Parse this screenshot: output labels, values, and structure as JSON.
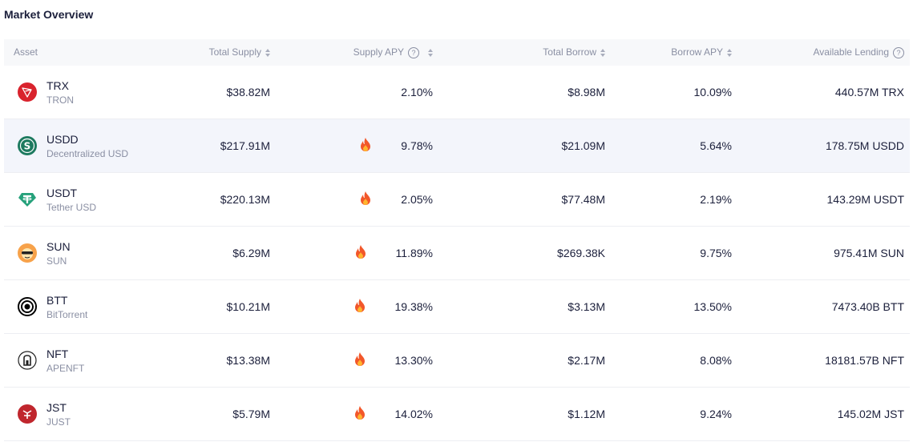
{
  "page": {
    "title": "Market Overview"
  },
  "table": {
    "headers": {
      "asset": "Asset",
      "total_supply": "Total Supply",
      "supply_apy": "Supply APY",
      "total_borrow": "Total Borrow",
      "borrow_apy": "Borrow APY",
      "available_lending": "Available Lending"
    },
    "rows": [
      {
        "symbol": "TRX",
        "name": "TRON",
        "total_supply": "$38.82M",
        "supply_apy": "2.10%",
        "hot": false,
        "total_borrow": "$8.98M",
        "borrow_apy": "10.09%",
        "available_lending": "440.57M TRX",
        "icon": "tron-icon",
        "color": "#d9232d"
      },
      {
        "symbol": "USDD",
        "name": "Decentralized USD",
        "total_supply": "$217.91M",
        "supply_apy": "9.78%",
        "hot": true,
        "total_borrow": "$21.09M",
        "borrow_apy": "5.64%",
        "available_lending": "178.75M USDD",
        "icon": "usdd-icon",
        "color": "#1d7a5f"
      },
      {
        "symbol": "USDT",
        "name": "Tether USD",
        "total_supply": "$220.13M",
        "supply_apy": "2.05%",
        "hot": true,
        "total_borrow": "$77.48M",
        "borrow_apy": "2.19%",
        "available_lending": "143.29M USDT",
        "icon": "tether-icon",
        "color": "#26a17b"
      },
      {
        "symbol": "SUN",
        "name": "SUN",
        "total_supply": "$6.29M",
        "supply_apy": "11.89%",
        "hot": true,
        "total_borrow": "$269.38K",
        "borrow_apy": "9.75%",
        "available_lending": "975.41M SUN",
        "icon": "sun-icon",
        "color": "#f7a24a"
      },
      {
        "symbol": "BTT",
        "name": "BitTorrent",
        "total_supply": "$10.21M",
        "supply_apy": "19.38%",
        "hot": true,
        "total_borrow": "$3.13M",
        "borrow_apy": "13.50%",
        "available_lending": "7473.40B BTT",
        "icon": "bittorrent-icon",
        "color": "#000000"
      },
      {
        "symbol": "NFT",
        "name": "APENFT",
        "total_supply": "$13.38M",
        "supply_apy": "13.30%",
        "hot": true,
        "total_borrow": "$2.17M",
        "borrow_apy": "8.08%",
        "available_lending": "18181.57B NFT",
        "icon": "apenft-icon",
        "color": "#222222"
      },
      {
        "symbol": "JST",
        "name": "JUST",
        "total_supply": "$5.79M",
        "supply_apy": "14.02%",
        "hot": true,
        "total_borrow": "$1.12M",
        "borrow_apy": "9.24%",
        "available_lending": "145.02M JST",
        "icon": "just-icon",
        "color": "#c0262d"
      }
    ]
  },
  "colors": {
    "hot": "#f2572a",
    "highlight_row": "#f3f5fb",
    "header_bg": "#f7f8fa",
    "muted_text": "#8a8fa3"
  }
}
